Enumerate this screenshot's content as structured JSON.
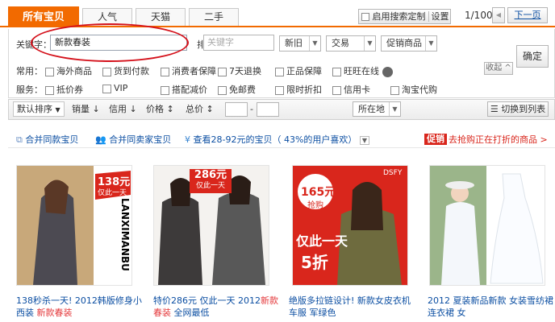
{
  "tabs": [
    {
      "label": "所有宝贝"
    },
    {
      "label": "人气"
    },
    {
      "label": "天猫"
    },
    {
      "label": "二手"
    }
  ],
  "top_right": {
    "only_custom_label": "启用搜索定制",
    "settings_label": "设置",
    "page_indicator": "1/100",
    "prev_icon": "◀",
    "next_label": "下一页"
  },
  "filters": {
    "keyword_label": "关键字：",
    "keyword_value": "新款春装",
    "exclude_label": "排除：",
    "exclude_placeholder": "关键字",
    "condition": "新旧",
    "trade": "交易",
    "promo": "促销商品",
    "confirm": "确定",
    "collapse": "收起",
    "common_label": "常用：",
    "service_label": "服务：",
    "common": [
      "海外商品",
      "货到付款",
      "消费者保障",
      "7天退换",
      "正品保障",
      "旺旺在线"
    ],
    "service": [
      "抵价券",
      "VIP",
      "搭配减价",
      "免邮费",
      "限时折扣",
      "信用卡",
      "淘宝代购"
    ]
  },
  "sort": {
    "default": "默认排序",
    "sales": "销量",
    "credit": "信用",
    "price": "价格",
    "total": "总价",
    "dash": "-",
    "location": "所在地",
    "view_toggle": "切换到列表"
  },
  "merge": {
    "same": "合并同款宝贝",
    "seller": "合并同卖家宝贝",
    "price_range": "查看28-92元的宝贝（ 43%的用户喜欢）",
    "promo_badge": "促销",
    "promo_text": "去抢购正在打折的商品 >"
  },
  "products": [
    {
      "title_blue": "138秒杀一天! 2012韩版修身小西装 ",
      "title_red": "新款春装",
      "price_tag": "138元",
      "tag_sub": "仅此一天",
      "brand": "LANXIMANBU"
    },
    {
      "title_blue": "特价286元 仅此一天 2012",
      "title_red": "新款春装",
      "title_blue2": " 全网最低",
      "price_tag": "286元",
      "tag_sub": "仅此一天"
    },
    {
      "title_blue": "绝版多拉链设计! 新款女皮衣机车服 军绿色",
      "price_tag": "165元",
      "tag_sub": "抢购",
      "banner": "仅此一天",
      "discount": "5折",
      "brand": "DSFY"
    },
    {
      "title_blue": "2012 夏装新品新款 女装雪纺裙连衣裙 女"
    }
  ]
}
